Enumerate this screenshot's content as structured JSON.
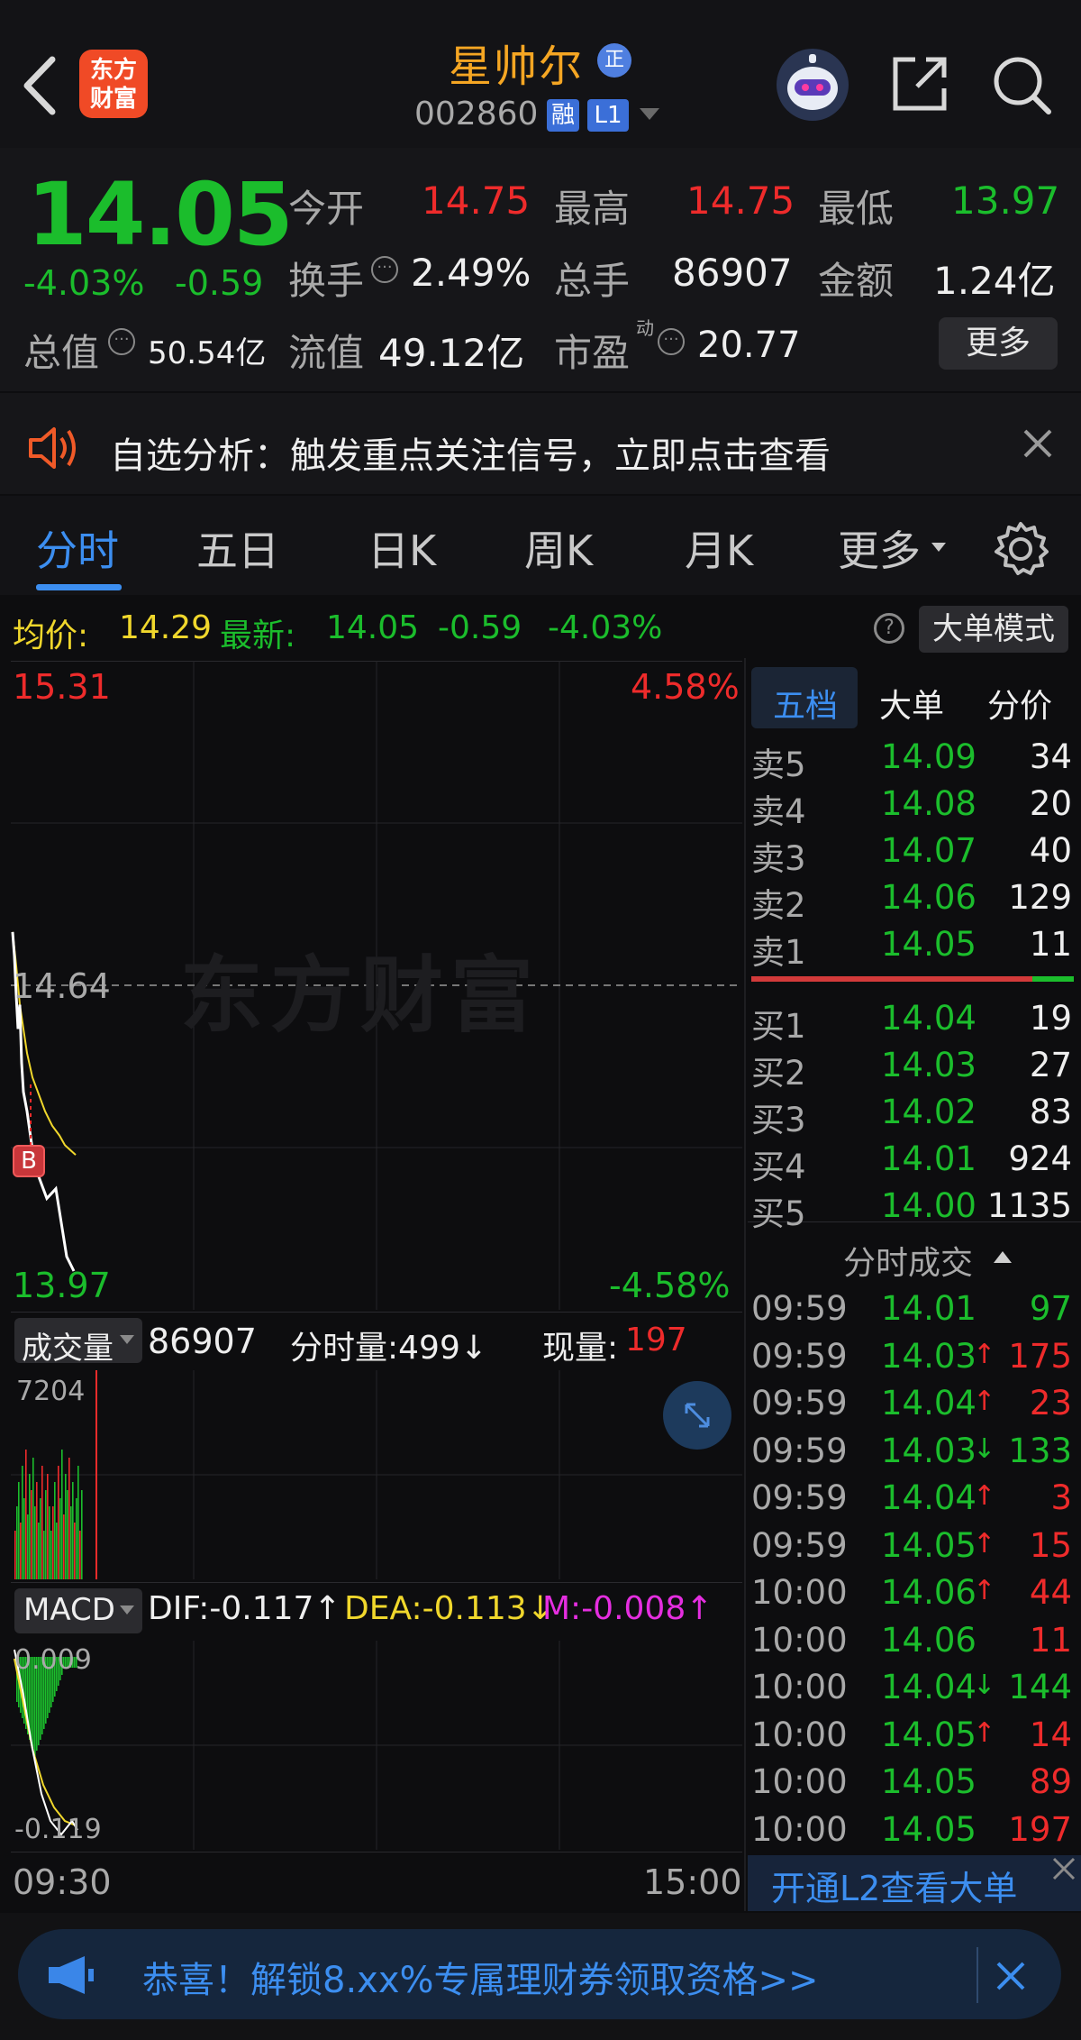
{
  "header": {
    "stock_name": "星帅尔",
    "badge": "正",
    "code": "002860",
    "tag_margin": "融",
    "tag_level": "L1",
    "logo_text_line1": "东方",
    "logo_text_line2": "财富",
    "icons": [
      "back-icon",
      "robot-icon",
      "share-icon",
      "search-icon"
    ]
  },
  "quote": {
    "price": "14.05",
    "change_pct": "-4.03%",
    "change": "-0.59",
    "fields": [
      {
        "label": "今开",
        "value": "14.75",
        "color": "red"
      },
      {
        "label": "最高",
        "value": "14.75",
        "color": "red"
      },
      {
        "label": "最低",
        "value": "13.97",
        "color": "green"
      },
      {
        "label": "换手",
        "value": "2.49%",
        "color": "white"
      },
      {
        "label": "总手",
        "value": "86907",
        "color": "white"
      },
      {
        "label": "金额",
        "value": "1.24亿",
        "color": "white"
      }
    ],
    "total_value_label": "总值",
    "total_value": "50.54亿",
    "float_value_label": "流值",
    "float_value": "49.12亿",
    "pe_label": "市盈",
    "pe_sup": "动",
    "pe_value": "20.77",
    "more_label": "更多"
  },
  "banner": {
    "text": "自选分析：触发重点关注信号，立即点击查看"
  },
  "tabs": [
    "分时",
    "五日",
    "日K",
    "周K",
    "月K",
    "更多"
  ],
  "chart_header": {
    "avg_label": "均价:",
    "avg_value": "14.29",
    "latest_label": "最新:",
    "latest_value": "14.05",
    "latest_change": "-0.59",
    "latest_pct": "-4.03%",
    "mode_button": "大单模式"
  },
  "chart_data": {
    "type": "line",
    "y_max": "15.31",
    "y_mid": "14.64",
    "y_min": "13.97",
    "pct_max": "4.58%",
    "pct_min": "-4.58%",
    "watermark": "东方财富",
    "buy_marker": "B",
    "time_start": "09:30",
    "time_end": "15:00",
    "series": [
      {
        "values": [
          14.75,
          14.7,
          14.62,
          14.55,
          14.6,
          14.48,
          14.42,
          14.38,
          14.3,
          14.25,
          14.2,
          14.22,
          14.15,
          14.08,
          14.05
        ]
      },
      {
        "values": [
          14.75,
          14.68,
          14.6,
          14.55,
          14.5,
          14.45,
          14.42,
          14.38,
          14.35,
          14.33,
          14.31,
          14.3,
          14.29
        ]
      }
    ]
  },
  "volume": {
    "label": "成交量",
    "total": "86907",
    "minute_label": "分时量:499↓",
    "current_label": "现量:",
    "current_value": "197",
    "max": "7204"
  },
  "macd": {
    "label": "MACD",
    "dif": "DIF:-0.117↑",
    "dea": "DEA:-0.113↓",
    "m": "M:-0.008↑",
    "top": "0.009",
    "bottom": "-0.119"
  },
  "orderbook": {
    "tabs": [
      "五档",
      "大单",
      "分价"
    ],
    "asks": [
      {
        "label": "卖5",
        "price": "14.09",
        "vol": "34"
      },
      {
        "label": "卖4",
        "price": "14.08",
        "vol": "20"
      },
      {
        "label": "卖3",
        "price": "14.07",
        "vol": "40"
      },
      {
        "label": "卖2",
        "price": "14.06",
        "vol": "129"
      },
      {
        "label": "卖1",
        "price": "14.05",
        "vol": "11"
      }
    ],
    "bids": [
      {
        "label": "买1",
        "price": "14.04",
        "vol": "19"
      },
      {
        "label": "买2",
        "price": "14.03",
        "vol": "27"
      },
      {
        "label": "买3",
        "price": "14.02",
        "vol": "83"
      },
      {
        "label": "买4",
        "price": "14.01",
        "vol": "924"
      },
      {
        "label": "买5",
        "price": "14.00",
        "vol": "1135"
      }
    ],
    "ticks_title": "分时成交",
    "ticks": [
      {
        "time": "09:59",
        "price": "14.01",
        "arrow": "",
        "vol": "97",
        "vcolor": "green"
      },
      {
        "time": "09:59",
        "price": "14.03",
        "arrow": "↑",
        "vol": "175",
        "vcolor": "red"
      },
      {
        "time": "09:59",
        "price": "14.04",
        "arrow": "↑",
        "vol": "23",
        "vcolor": "red"
      },
      {
        "time": "09:59",
        "price": "14.03",
        "arrow": "↓",
        "vol": "133",
        "vcolor": "green"
      },
      {
        "time": "09:59",
        "price": "14.04",
        "arrow": "↑",
        "vol": "3",
        "vcolor": "red"
      },
      {
        "time": "09:59",
        "price": "14.05",
        "arrow": "↑",
        "vol": "15",
        "vcolor": "red"
      },
      {
        "time": "10:00",
        "price": "14.06",
        "arrow": "↑",
        "vol": "44",
        "vcolor": "red"
      },
      {
        "time": "10:00",
        "price": "14.06",
        "arrow": "",
        "vol": "11",
        "vcolor": "red"
      },
      {
        "time": "10:00",
        "price": "14.04",
        "arrow": "↓",
        "vol": "144",
        "vcolor": "green"
      },
      {
        "time": "10:00",
        "price": "14.05",
        "arrow": "↑",
        "vol": "14",
        "vcolor": "red"
      },
      {
        "time": "10:00",
        "price": "14.05",
        "arrow": "",
        "vol": "89",
        "vcolor": "red"
      },
      {
        "time": "10:00",
        "price": "14.05",
        "arrow": "",
        "vol": "197",
        "vcolor": "red"
      }
    ],
    "l2_link": "开通L2查看大单"
  },
  "ad": {
    "text": "恭喜！解锁8.xx%专属理财券领取资格>>"
  }
}
